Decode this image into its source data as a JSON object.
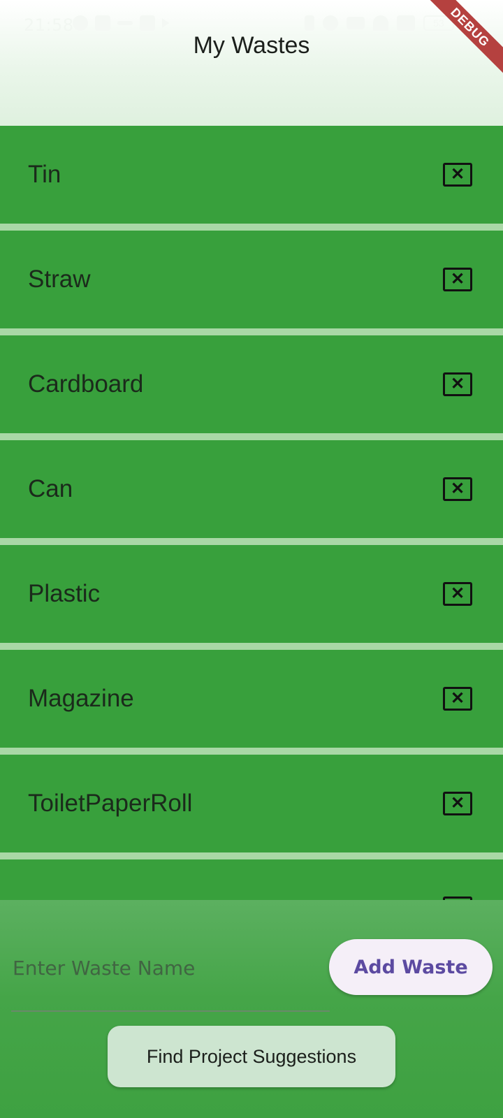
{
  "status_bar": {
    "time": "21:58",
    "battery": "53"
  },
  "debug_banner": "DEBUG",
  "header": {
    "title": "My Wastes"
  },
  "wastes": [
    {
      "label": "Tin",
      "delete_icon": "close-box-icon"
    },
    {
      "label": "Straw",
      "delete_icon": "close-box-icon"
    },
    {
      "label": "Cardboard",
      "delete_icon": "close-box-icon"
    },
    {
      "label": "Can",
      "delete_icon": "close-box-icon"
    },
    {
      "label": "Plastic",
      "delete_icon": "close-box-icon"
    },
    {
      "label": "Magazine",
      "delete_icon": "close-box-icon"
    },
    {
      "label": "ToiletPaperRoll",
      "delete_icon": "close-box-icon"
    },
    {
      "label": "",
      "delete_icon": "close-box-icon"
    }
  ],
  "form": {
    "input_placeholder": "Enter Waste Name",
    "input_value": "",
    "add_button_label": "Add Waste",
    "find_button_label": "Find Project Suggestions"
  },
  "colors": {
    "item_background": "#38a03c",
    "list_gap": "#a9d8a6",
    "accent_text": "#5c4aa1"
  }
}
